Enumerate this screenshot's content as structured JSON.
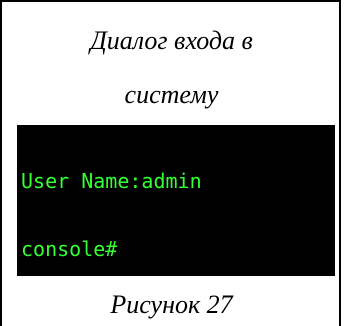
{
  "dialog_caption": {
    "line1": "Диалог входа в",
    "line2": "систему"
  },
  "terminal": {
    "lines": [
      "User Name:admin",
      "console#"
    ],
    "text_color": "#33ff33",
    "background_color": "#000000"
  },
  "figure_caption": "Рисунок 27"
}
